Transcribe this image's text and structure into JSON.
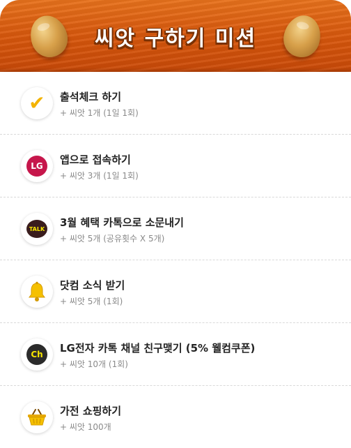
{
  "header": {
    "title": "씨앗 구하기 미션",
    "colors": {
      "wood": "#d7560c",
      "title_outline": "#7a3104"
    }
  },
  "missions": [
    {
      "title": "출석체크 하기",
      "reward": "+ 씨앗 1개 (1일 1회)",
      "icon": "check-icon"
    },
    {
      "title": "앱으로 접속하기",
      "reward": "+ 씨앗 3개 (1일 1회)",
      "icon": "lg-logo-icon",
      "logo_text": "LG"
    },
    {
      "title": "3월 혜택 카톡으로 소문내기",
      "reward": "+ 씨앗 5개 (공유횟수 X 5개)",
      "icon": "kakaotalk-icon",
      "logo_text": "TALK"
    },
    {
      "title": "닷컴 소식 받기",
      "reward": "+ 씨앗 5개 (1회)",
      "icon": "bell-icon"
    },
    {
      "title": "LG전자 카톡 채널 친구맺기 (5% 웰컴쿠폰)",
      "reward": "+ 씨앗 10개 (1회)",
      "icon": "kakao-channel-icon",
      "logo_text": "Ch"
    },
    {
      "title": "가전 쇼핑하기",
      "reward": "+ 씨앗 100개",
      "icon": "shopping-basket-icon"
    }
  ]
}
